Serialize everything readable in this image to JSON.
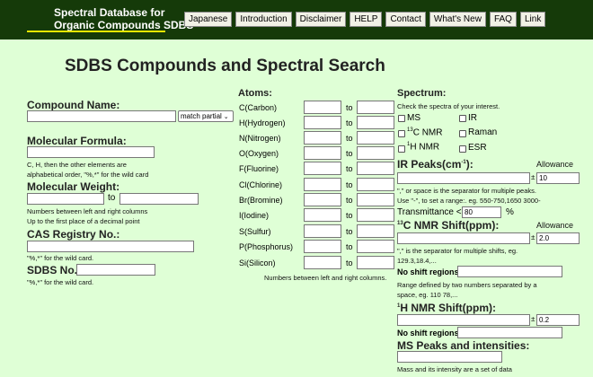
{
  "header": {
    "brand_line1": "Spectral Database for",
    "brand_line2": "Organic Compounds SDBS",
    "nav": [
      "Japanese",
      "Introduction",
      "Disclaimer",
      "HELP",
      "Contact",
      "What's New",
      "FAQ",
      "Link"
    ]
  },
  "page_title": "SDBS Compounds and Spectral Search",
  "compound": {
    "name_label": "Compound Name:",
    "match_select": "match partial",
    "formula_label": "Molecular Formula:",
    "formula_help1": "C, H, then the other elements are",
    "formula_help2": "alphabetical order, \"%,*\" for the wild card",
    "weight_label": "Molecular Weight:",
    "weight_to": "to",
    "weight_help1": "Numbers between left and right columns",
    "weight_help2": "Up to the first place of a decimal point",
    "cas_label": "CAS Registry No.:",
    "cas_help": "\"%,*\" for the wild card.",
    "sdbs_label": "SDBS No.:",
    "sdbs_help": "\"%,*\" for the wild card."
  },
  "atoms": {
    "title": "Atoms:",
    "to": "to",
    "rows": [
      "C(Carbon)",
      "H(Hydrogen)",
      "N(Nitrogen)",
      "O(Oxygen)",
      "F(Fluorine)",
      "Cl(Chlorine)",
      "Br(Bromine)",
      "I(Iodine)",
      "S(Sulfur)",
      "P(Phosphorus)",
      "Si(Silicon)"
    ],
    "help": "Numbers between left and right columns."
  },
  "spectrum": {
    "title": "Spectrum:",
    "help": "Check the spectra of your interest.",
    "checks": {
      "ms": "MS",
      "ir": "IR",
      "c13_pre": "13",
      "c13": "C NMR",
      "raman": "Raman",
      "h1_pre": "1",
      "h1": "H NMR",
      "esr": "ESR"
    },
    "ir_label_a": "IR Peaks(cm",
    "ir_label_sup": "-1",
    "ir_label_b": "):",
    "allowance": "Allowance",
    "pm": "±",
    "ir_allow": "10",
    "ir_help1": "\",\" or space is the separator for multiple peaks.",
    "ir_help2": "Use \"-\", to set a range:. eg. 550-750,1650 3000-",
    "transmittance": "Transmittance <",
    "transmittance_val": "80",
    "percent": "%",
    "c13_label_pre": "13",
    "c13_label": "C NMR Shift(ppm):",
    "c13_allow": "2.0",
    "c13_help1": "\",\" is the separator for multiple shifts, eg.",
    "c13_help2": "129.3,18.4,...",
    "noshift1": "No shift regions:",
    "range_help1": "Range defined by two numbers separated by a",
    "range_help2": "space, eg. 110 78,...",
    "h1_label_pre": "1",
    "h1_label": "H NMR Shift(ppm):",
    "h1_allow": "0.2",
    "noshift2": "No shift regions:",
    "ms_label": "MS Peaks and intensities:",
    "ms_help": "Mass and its intensity are a set of data"
  }
}
